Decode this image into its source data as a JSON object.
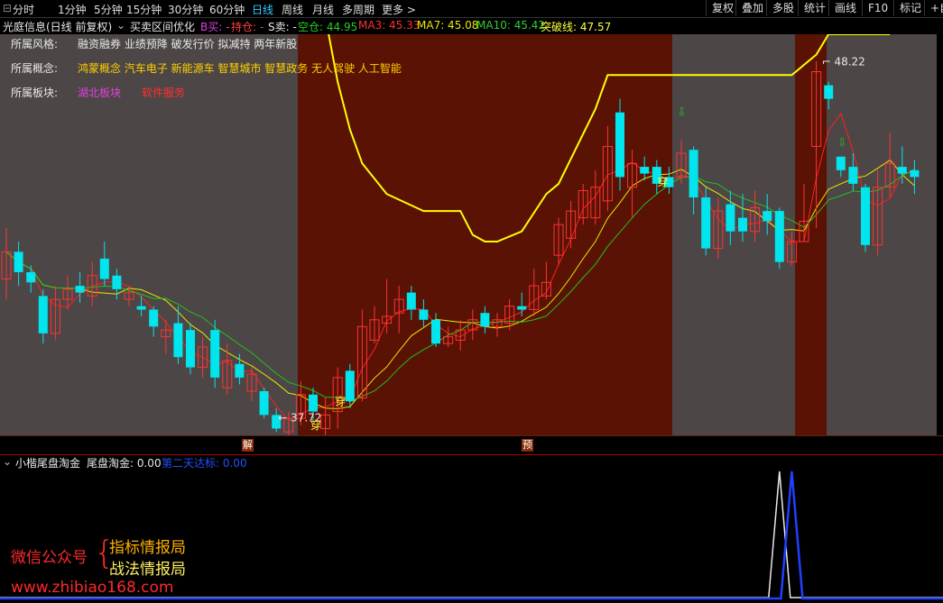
{
  "toolbar": {
    "periods": [
      "分时",
      "1分钟",
      "5分钟",
      "15分钟",
      "30分钟",
      "60分钟",
      "日线",
      "周线",
      "月线",
      "多周期",
      "更多 >"
    ],
    "active_period": "日线",
    "buttons": [
      "复权",
      "叠加",
      "多股",
      "统计",
      "画线",
      "F10",
      "标记",
      "+自"
    ]
  },
  "info": {
    "stock": "光庭信息(日线 前复权)",
    "indicator": "买卖区间优化",
    "b_buy": "B买: -",
    "position": "持仓: -",
    "s_sell": "S卖: -",
    "empty": "空仓: 44.95",
    "ma3": "MA3: 45.33",
    "ma7": "MA7: 45.08",
    "ma10": "MA10: 45.42",
    "breakout": "突破线: 47.57"
  },
  "profile": {
    "style_label": "所属风格:",
    "style_value": "融资融券 业绩预降 破发行价 拟减持 两年新股",
    "concept_label": "所属概念:",
    "concept_value": "鸿蒙概念 汽车电子 新能源车 智慧城市 智慧政务 无人驾驶 人工智能",
    "sector_label": "所属板块:",
    "sector_a": "湖北板块",
    "sector_b": "软件服务"
  },
  "annotations": {
    "high": "48.22",
    "low": "37.72",
    "chuan": "穿"
  },
  "markers": {
    "jie": "解",
    "yu": "预"
  },
  "sub": {
    "title": "小楷尾盘淘金",
    "weipan": "尾盘淘金: 0.00",
    "second_day": "第二天达标: 0.00"
  },
  "watermark": {
    "wechat": "微信公众号",
    "brace": "{",
    "line1": "指标情报局",
    "line2": "战法情报局",
    "url": "www.zhibiao168.com"
  },
  "colors": {
    "up": "#ff3232",
    "down": "#00e5ee",
    "shade_gray": "#4d4646",
    "shade_red": "#5a1205",
    "yellow_line": "#ffff00",
    "ma_red": "#ff2020",
    "ma_yellow": "#e8e800",
    "ma_green": "#20c020"
  },
  "candles": [
    [
      41.8,
      42.6,
      41.2,
      43.3
    ],
    [
      42.6,
      42.0,
      41.6,
      42.9
    ],
    [
      42.0,
      41.7,
      41.4,
      42.2
    ],
    [
      41.3,
      40.2,
      39.9,
      41.5
    ],
    [
      40.2,
      41.2,
      40.0,
      41.6
    ],
    [
      41.2,
      41.5,
      40.9,
      41.9
    ],
    [
      41.6,
      41.4,
      41.1,
      42.0
    ],
    [
      41.3,
      41.9,
      41.0,
      42.3
    ],
    [
      42.4,
      41.8,
      41.6,
      42.9
    ],
    [
      41.9,
      41.5,
      41.2,
      42.1
    ],
    [
      41.2,
      41.4,
      41.0,
      41.6
    ],
    [
      41.0,
      40.9,
      40.7,
      41.3
    ],
    [
      40.9,
      40.4,
      40.1,
      41.0
    ],
    [
      40.1,
      40.3,
      39.6,
      40.6
    ],
    [
      40.5,
      39.5,
      39.3,
      41.0
    ],
    [
      40.3,
      39.2,
      39.0,
      40.5
    ],
    [
      39.2,
      39.8,
      38.9,
      40.1
    ],
    [
      40.3,
      38.9,
      38.6,
      40.6
    ],
    [
      38.6,
      39.4,
      38.4,
      39.9
    ],
    [
      39.3,
      38.9,
      38.7,
      39.6
    ],
    [
      38.5,
      39.0,
      38.2,
      39.2
    ],
    [
      38.5,
      37.8,
      37.7,
      38.6
    ],
    [
      37.8,
      37.4,
      37.3,
      38.0
    ],
    [
      37.3,
      37.7,
      37.0,
      37.9
    ],
    [
      37.7,
      38.4,
      37.5,
      38.8
    ],
    [
      38.4,
      37.9,
      37.6,
      38.6
    ],
    [
      37.4,
      37.8,
      37.1,
      38.3
    ],
    [
      37.9,
      38.9,
      37.4,
      39.2
    ],
    [
      39.1,
      38.2,
      38.0,
      39.3
    ],
    [
      38.3,
      40.4,
      38.2,
      40.9
    ],
    [
      40.0,
      40.6,
      39.9,
      41.0
    ],
    [
      40.5,
      40.7,
      40.2,
      41.8
    ],
    [
      40.8,
      41.2,
      40.2,
      41.6
    ],
    [
      41.4,
      40.9,
      40.6,
      41.6
    ],
    [
      40.9,
      40.6,
      40.4,
      41.2
    ],
    [
      40.6,
      39.9,
      39.8,
      40.8
    ],
    [
      39.9,
      40.1,
      39.8,
      40.4
    ],
    [
      40.0,
      40.3,
      39.7,
      40.6
    ],
    [
      40.3,
      40.6,
      40.0,
      40.9
    ],
    [
      40.8,
      40.4,
      40.2,
      41.0
    ],
    [
      40.4,
      40.6,
      40.1,
      40.8
    ],
    [
      40.5,
      41.0,
      40.3,
      41.2
    ],
    [
      41.0,
      40.9,
      40.7,
      41.4
    ],
    [
      40.9,
      41.6,
      40.7,
      42.1
    ],
    [
      41.3,
      41.7,
      41.2,
      42.3
    ],
    [
      42.5,
      43.4,
      42.2,
      43.6
    ],
    [
      43.0,
      43.8,
      42.7,
      44.1
    ],
    [
      43.6,
      44.4,
      43.4,
      44.6
    ],
    [
      43.6,
      44.5,
      43.4,
      45.0
    ],
    [
      44.1,
      45.7,
      43.8,
      46.3
    ],
    [
      46.7,
      44.8,
      44.4,
      47.1
    ],
    [
      44.5,
      45.2,
      43.6,
      45.6
    ],
    [
      45.1,
      44.9,
      44.7,
      45.4
    ],
    [
      45.1,
      44.6,
      44.3,
      45.3
    ],
    [
      44.8,
      44.5,
      44.3,
      45.1
    ],
    [
      44.8,
      45.5,
      44.6,
      45.9
    ],
    [
      45.6,
      44.2,
      43.7,
      45.7
    ],
    [
      44.2,
      42.7,
      42.5,
      44.5
    ],
    [
      42.7,
      43.8,
      42.4,
      44.2
    ],
    [
      44.0,
      43.2,
      42.8,
      44.4
    ],
    [
      43.6,
      43.2,
      42.9,
      44.3
    ],
    [
      43.2,
      43.9,
      42.9,
      44.4
    ],
    [
      43.8,
      43.5,
      43.1,
      44.3
    ],
    [
      43.8,
      42.3,
      42.1,
      43.9
    ],
    [
      42.3,
      42.9,
      42.2,
      43.2
    ],
    [
      42.9,
      43.5,
      42.9,
      44.6
    ],
    [
      45.7,
      47.9,
      43.3,
      48.2
    ],
    [
      47.5,
      47.1,
      46.8,
      47.6
    ],
    [
      45.4,
      45.0,
      44.8,
      45.4
    ],
    [
      45.1,
      44.6,
      44.4,
      45.5
    ],
    [
      44.5,
      42.8,
      42.6,
      44.6
    ],
    [
      42.8,
      44.5,
      42.5,
      45.0
    ],
    [
      44.5,
      45.2,
      44.2,
      46.1
    ],
    [
      45.1,
      44.9,
      44.6,
      45.7
    ],
    [
      45.0,
      44.8,
      44.3,
      45.3
    ]
  ],
  "sub_white_peak_idx": 63,
  "sub_blue_peak_idx": 64
}
